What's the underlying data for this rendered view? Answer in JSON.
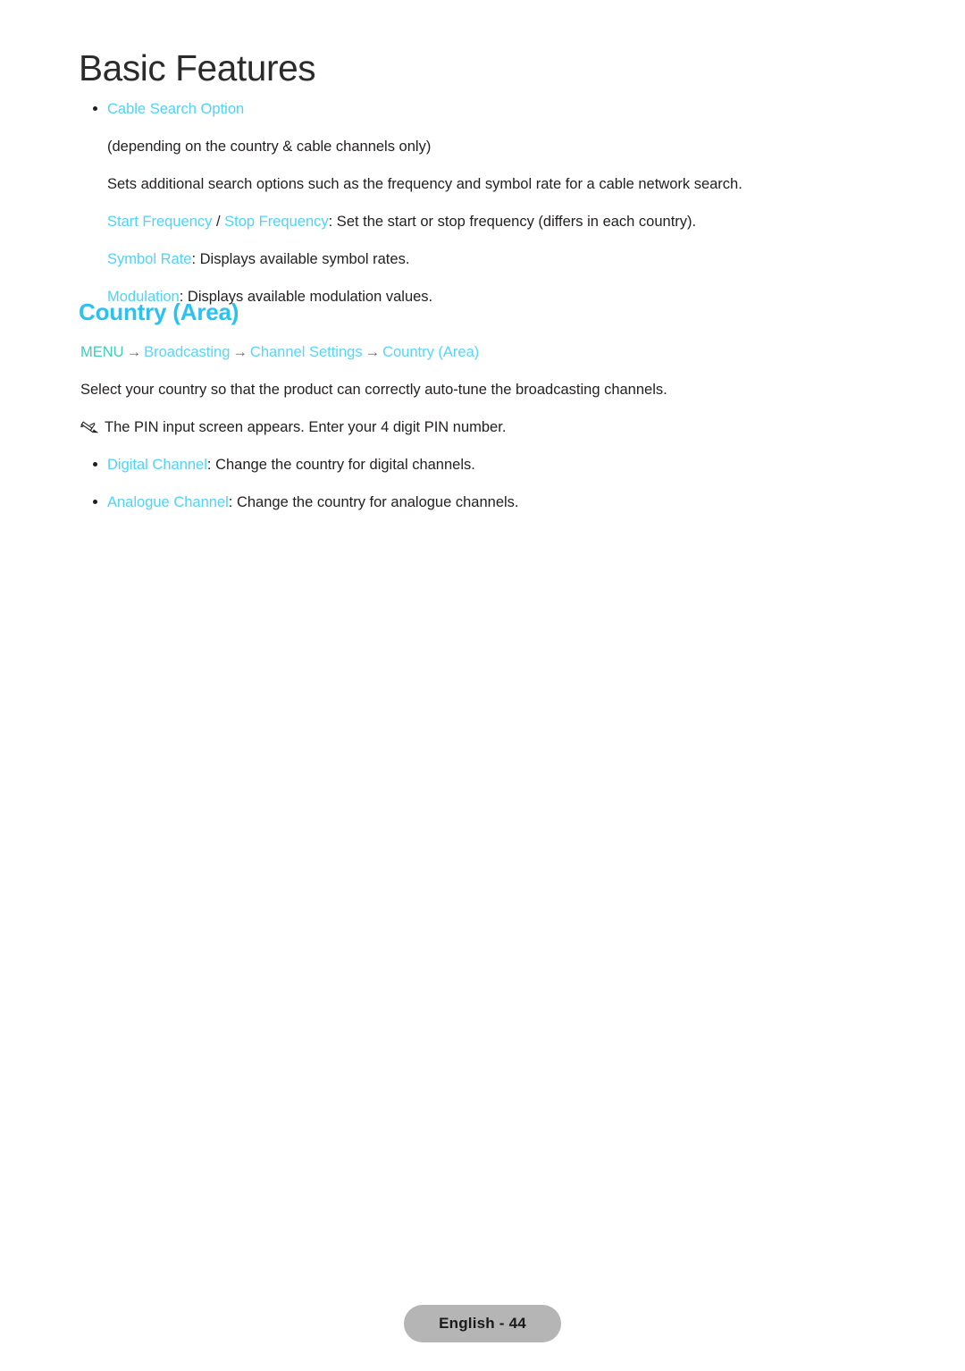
{
  "page": {
    "chapter_title": "Basic Features",
    "background_color": "#ffffff",
    "body_text_color": "#231f20"
  },
  "colors": {
    "accent_cyan": "#4fd3f7",
    "heading_cyan": "#29c2f2",
    "menu_teal": "#3ccfb6",
    "footer_badge_bg": "#b5b5b5"
  },
  "section_cable_search": {
    "bullet_term": "Cable Search Option",
    "condition_note": "(depending on the country & cable channels only)",
    "description": "Sets additional search options such as the frequency and symbol rate for a cable network search.",
    "items": [
      {
        "term_a": "Start Frequency",
        "separator": " / ",
        "term_b": "Stop Frequency",
        "rest": ": Set the start or stop frequency (differs in each country)."
      },
      {
        "term_a": "Symbol Rate",
        "rest": ": Displays available symbol rates."
      },
      {
        "term_a": "Modulation",
        "rest": ": Displays available modulation values."
      }
    ]
  },
  "section_country_area": {
    "heading": "Country (Area)",
    "breadcrumb": {
      "root": "MENU",
      "arrow": "→",
      "steps": [
        "Broadcasting",
        "Channel Settings",
        "Country (Area)"
      ]
    },
    "description": "Select your country so that the product can correctly auto-tune the broadcasting channels.",
    "note": {
      "icon": "pencil-note-icon",
      "text": "The PIN input screen appears. Enter your 4 digit PIN number."
    },
    "items": [
      {
        "term": "Digital Channel",
        "rest": ": Change the country for digital channels."
      },
      {
        "term": "Analogue Channel",
        "rest": ": Change the country for analogue channels."
      }
    ]
  },
  "footer": {
    "label": "English - 44"
  }
}
